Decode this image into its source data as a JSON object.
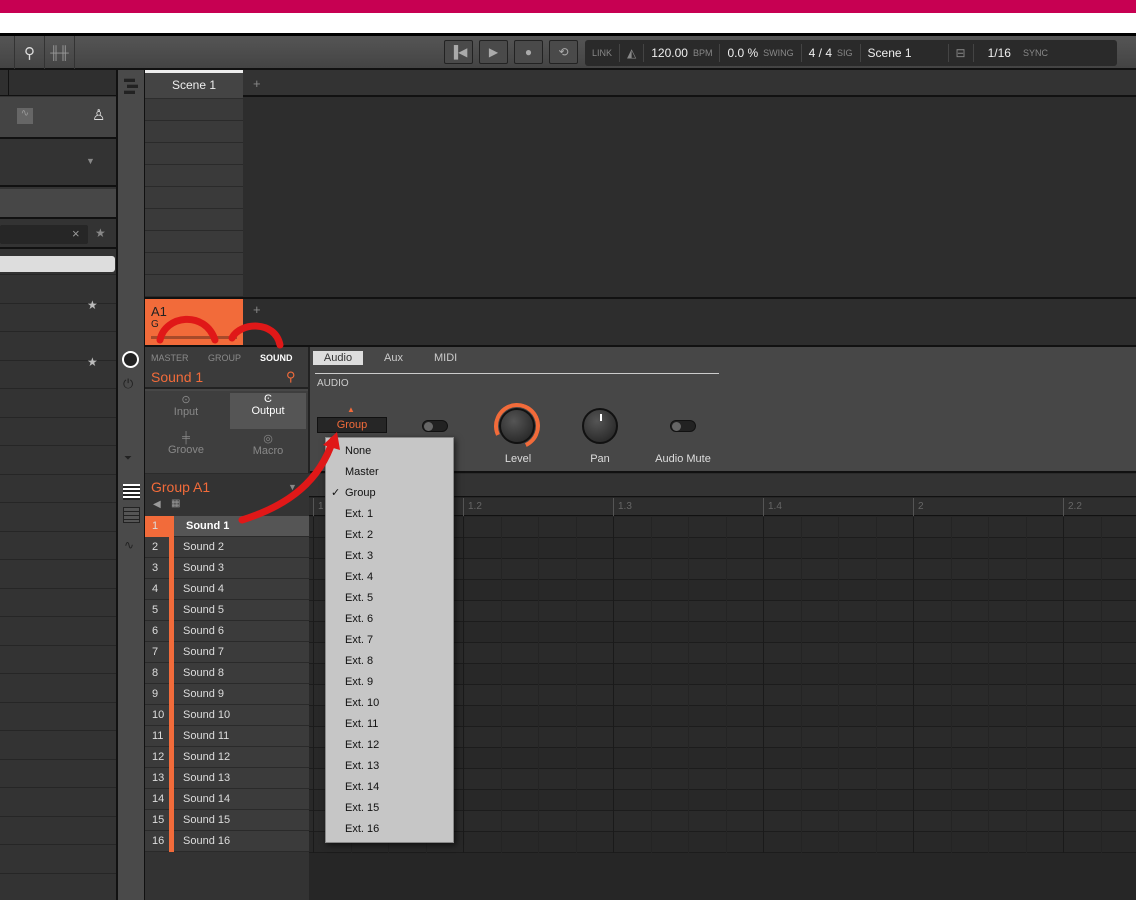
{
  "toolbar": {
    "search_icon": "search-icon",
    "mixer_icon": "mixer-icon",
    "transport": {
      "restart": "restart-icon",
      "play": "play-icon",
      "record": "record-icon",
      "loop": "loop-icon"
    },
    "link": "LINK",
    "tempo": "120.00",
    "tempo_unit": "BPM",
    "swing": "0.0 %",
    "swing_label": "SWING",
    "sig": "4 / 4",
    "sig_label": "SIG",
    "scene": "Scene 1",
    "quant": "1/16",
    "sync": "SYNC"
  },
  "browser": {
    "x": "×",
    "star": "★"
  },
  "arranger": {
    "scene_tab": "Scene 1",
    "add": "+",
    "pattern": "A1",
    "pattern_sub": "G",
    "add_pattern": "+"
  },
  "control": {
    "tabs": [
      "MASTER",
      "GROUP",
      "SOUND"
    ],
    "sound_name": "Sound 1",
    "modes": {
      "input": "Input",
      "output": "Output",
      "groove": "Groove",
      "macro": "Macro"
    },
    "subtabs": [
      "Audio",
      "Aux",
      "MIDI"
    ],
    "section": "AUDIO",
    "dest": "Group",
    "level": "Level",
    "pan": "Pan",
    "mute": "Audio Mute"
  },
  "group": {
    "name": "Group A1",
    "sounds": [
      "Sound 1",
      "Sound 2",
      "Sound 3",
      "Sound 4",
      "Sound 5",
      "Sound 6",
      "Sound 7",
      "Sound 8",
      "Sound 9",
      "Sound 10",
      "Sound 11",
      "Sound 12",
      "Sound 13",
      "Sound 14",
      "Sound 15",
      "Sound 16"
    ]
  },
  "ruler": [
    "1",
    "1.2",
    "1.3",
    "1.4",
    "2",
    "2.2"
  ],
  "dropdown": {
    "items": [
      "None",
      "Master",
      "Group",
      "Ext. 1",
      "Ext. 2",
      "Ext. 3",
      "Ext. 4",
      "Ext. 5",
      "Ext. 6",
      "Ext. 7",
      "Ext. 8",
      "Ext. 9",
      "Ext. 10",
      "Ext. 11",
      "Ext. 12",
      "Ext. 13",
      "Ext. 14",
      "Ext. 15",
      "Ext. 16"
    ],
    "selected": "Group"
  },
  "colors": {
    "accent": "#f26b3a",
    "brand": "#c70052",
    "annotation": "#e01818"
  }
}
